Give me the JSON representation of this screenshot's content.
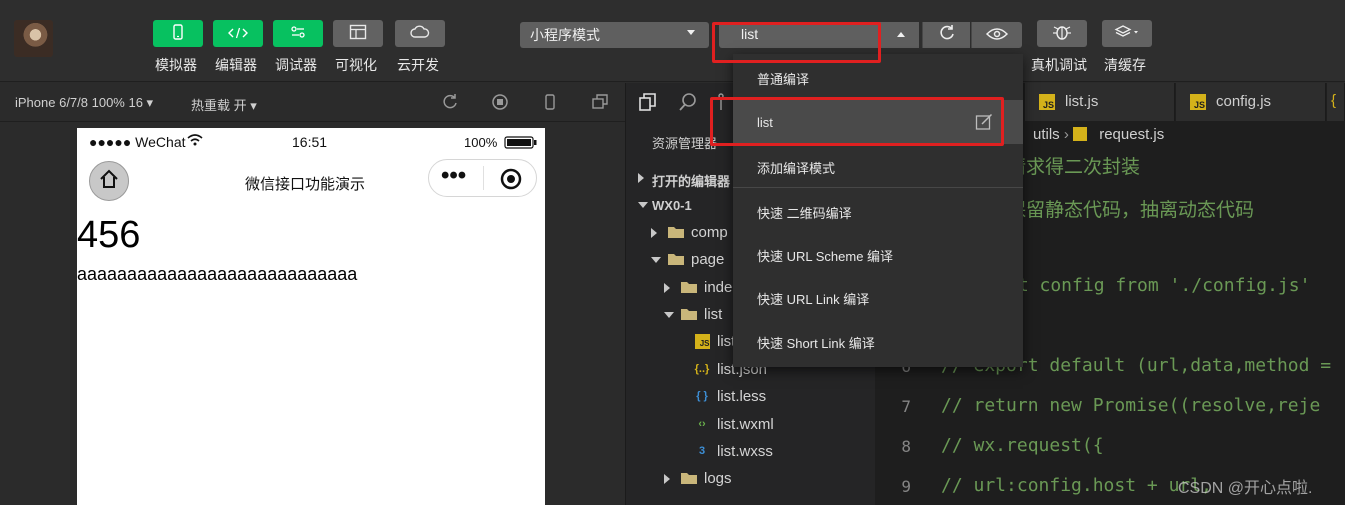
{
  "toolbar": {
    "buttons": [
      {
        "label": "模拟器",
        "icon": "phone-icon"
      },
      {
        "label": "编辑器",
        "icon": "code-icon"
      },
      {
        "label": "调试器",
        "icon": "sliders-icon"
      },
      {
        "label": "可视化",
        "icon": "layout-icon"
      },
      {
        "label": "云开发",
        "icon": "cloud-icon"
      }
    ],
    "mode_select": "小程序模式",
    "compile_select": "list",
    "right_buttons": [
      {
        "label": "真机调试",
        "icon": "bug-icon"
      },
      {
        "label": "清缓存",
        "icon": "layers-icon"
      }
    ]
  },
  "subbar": {
    "device": "iPhone 6/7/8 100% 16",
    "hot_reload": "热重载 开"
  },
  "phone": {
    "status_carrier": "●●●●● WeChat",
    "status_time": "16:51",
    "status_battery": "100%",
    "nav_title": "微信接口功能演示",
    "capsule_dots": "•••",
    "number": "456",
    "text": "aaaaaaaaaaaaaaaaaaaaaaaaaaaa"
  },
  "explorer": {
    "title": "资源管理器",
    "tree": [
      {
        "label": "打开的编辑器",
        "arrow": "right",
        "indent": 0,
        "icon": ""
      },
      {
        "label": "WX0-1",
        "arrow": "down",
        "indent": 0,
        "icon": ""
      },
      {
        "label": "comp",
        "arrow": "right",
        "indent": 1,
        "icon": "folder-icon"
      },
      {
        "label": "page",
        "arrow": "down",
        "indent": 1,
        "icon": "folder-icon"
      },
      {
        "label": "inde",
        "arrow": "right",
        "indent": 2,
        "icon": "folder-icon"
      },
      {
        "label": "list",
        "arrow": "down",
        "indent": 2,
        "icon": "folder-open-icon"
      },
      {
        "label": "list",
        "arrow": "",
        "indent": 3,
        "icon": "js-file-icon"
      },
      {
        "label": "list.json",
        "arrow": "",
        "indent": 3,
        "icon": "json-file-icon"
      },
      {
        "label": "list.less",
        "arrow": "",
        "indent": 3,
        "icon": "less-file-icon"
      },
      {
        "label": "list.wxml",
        "arrow": "",
        "indent": 3,
        "icon": "wxml-file-icon"
      },
      {
        "label": "list.wxss",
        "arrow": "",
        "indent": 3,
        "icon": "wxss-file-icon"
      },
      {
        "label": "logs",
        "arrow": "right",
        "indent": 2,
        "icon": "folder-icon"
      }
    ]
  },
  "editor": {
    "tabs": [
      {
        "label": "list.js"
      },
      {
        "label": "config.js"
      }
    ],
    "breadcrumb_folder": "utils",
    "breadcrumb_file": "request.js",
    "comment_lines": [
      "请求得二次封装",
      "保留静态代码，抽离动态代码"
    ],
    "import_line": "rt config from './config.js'",
    "code_lines": [
      {
        "ln": "6",
        "text": "//  export default (url,data,method ="
      },
      {
        "ln": "7",
        "text": "//   return new Promise((resolve,reje"
      },
      {
        "ln": "8",
        "text": "//     wx.request({"
      },
      {
        "ln": "9",
        "text": "//       url:config.host + url,"
      }
    ]
  },
  "dropdown": {
    "items": [
      {
        "label": "普通编译"
      },
      {
        "label": "list"
      },
      {
        "label": "添加编译模式"
      },
      {
        "label": "快速 二维码编译"
      },
      {
        "label": "快速 URL Scheme 编译"
      },
      {
        "label": "快速 URL Link 编译"
      },
      {
        "label": "快速 Short Link 编译"
      }
    ]
  },
  "watermark": "CSDN @开心点啦.",
  "colors": {
    "accent_green": "#07c160",
    "highlight_red": "#e02020",
    "comment_green": "#6a9955"
  }
}
